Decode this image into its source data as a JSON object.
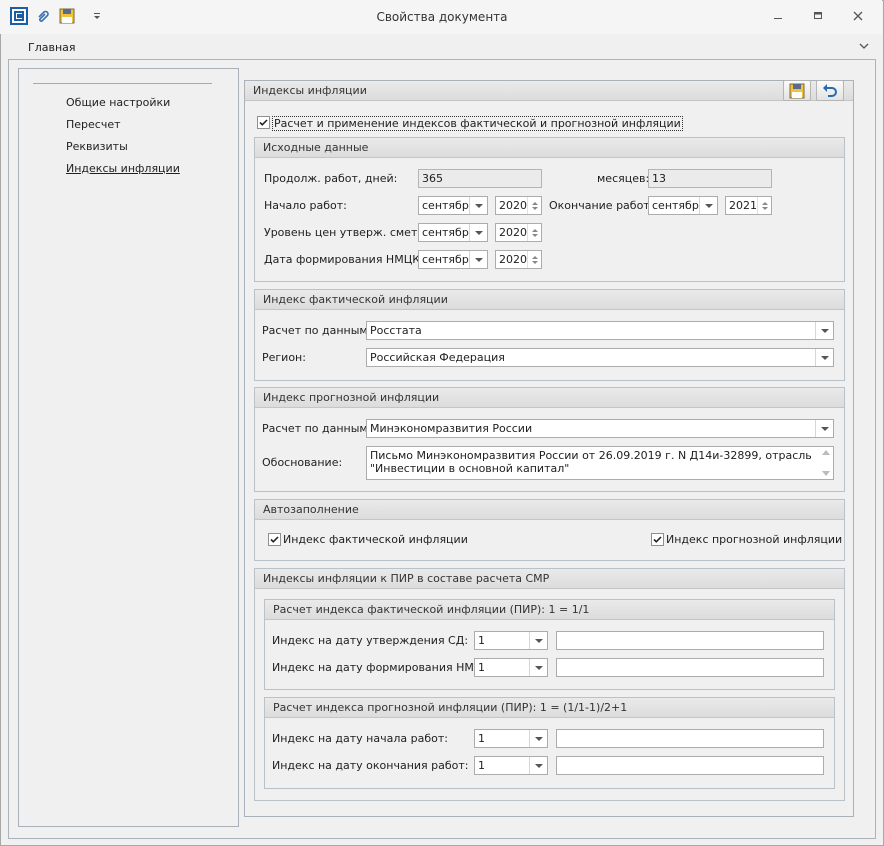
{
  "window": {
    "title": "Свойства документа",
    "minimize_icon": "minimize-icon",
    "restore_icon": "restore-icon",
    "close_icon": "close-icon"
  },
  "ribbon": {
    "tab": "Главная"
  },
  "nav": {
    "items": [
      {
        "label": "Общие настройки"
      },
      {
        "label": "Пересчет"
      },
      {
        "label": "Реквизиты"
      },
      {
        "label": "Индексы инфляции",
        "selected": true
      }
    ]
  },
  "panel": {
    "title": "Индексы инфляции",
    "apply_checkbox": {
      "label": "Расчет и применение индексов фактической и прогнозной инфляции",
      "checked": true
    },
    "source": {
      "title": "Исходные данные",
      "duration_label": "Продолж. работ, дней:",
      "duration_value": "365",
      "months_label": "месяцев:",
      "months_value": "13",
      "start_label": "Начало работ:",
      "start_month": "сентябрь",
      "start_year": "2020",
      "end_label": "Окончание работ:",
      "end_month": "сентябрь",
      "end_year": "2021",
      "price_label": "Уровень цен утверж. сметы:",
      "price_month": "сентябрь",
      "price_year": "2020",
      "nmck_label": "Дата формирования НМЦК:",
      "nmck_month": "сентябрь",
      "nmck_year": "2020"
    },
    "actual": {
      "title": "Индекс фактической инфляции",
      "calc_label": "Расчет по данным:",
      "calc_value": "Росстата",
      "region_label": "Регион:",
      "region_value": "Российская Федерация"
    },
    "forecast": {
      "title": "Индекс прогнозной инфляции",
      "calc_label": "Расчет по данным:",
      "calc_value": "Минэкономразвития России",
      "basis_label": "Обоснование:",
      "basis_line1": "Письмо Минэкономразвития России от 26.09.2019 г. N Д14и-32899, отрасль",
      "basis_line2": "\"Инвестиции в основной капитал\""
    },
    "autofill": {
      "title": "Автозаполнение",
      "actual_label": "Индекс фактической инфляции",
      "actual_checked": true,
      "forecast_label": "Индекс прогнозной инфляции",
      "forecast_checked": true
    },
    "pir": {
      "title": "Индексы инфляции к ПИР в составе расчета СМР",
      "actual": {
        "title": "Расчет индекса фактической инфляции (ПИР): 1 = 1/1",
        "approve_label": "Индекс на дату утверждения СД:",
        "approve_value": "1",
        "nmck_label": "Индекс на дату формирования НМЦК:",
        "nmck_value": "1"
      },
      "forecast": {
        "title": "Расчет индекса прогнозной инфляции (ПИР): 1 = (1/1-1)/2+1",
        "start_label": "Индекс на дату начала работ:",
        "start_value": "1",
        "end_label": "Индекс на дату окончания работ:",
        "end_value": "1"
      }
    }
  },
  "colors": {
    "accent": "#1b5ea8",
    "border": "#b9c1c9",
    "header_bg": "#e2e2e2"
  }
}
